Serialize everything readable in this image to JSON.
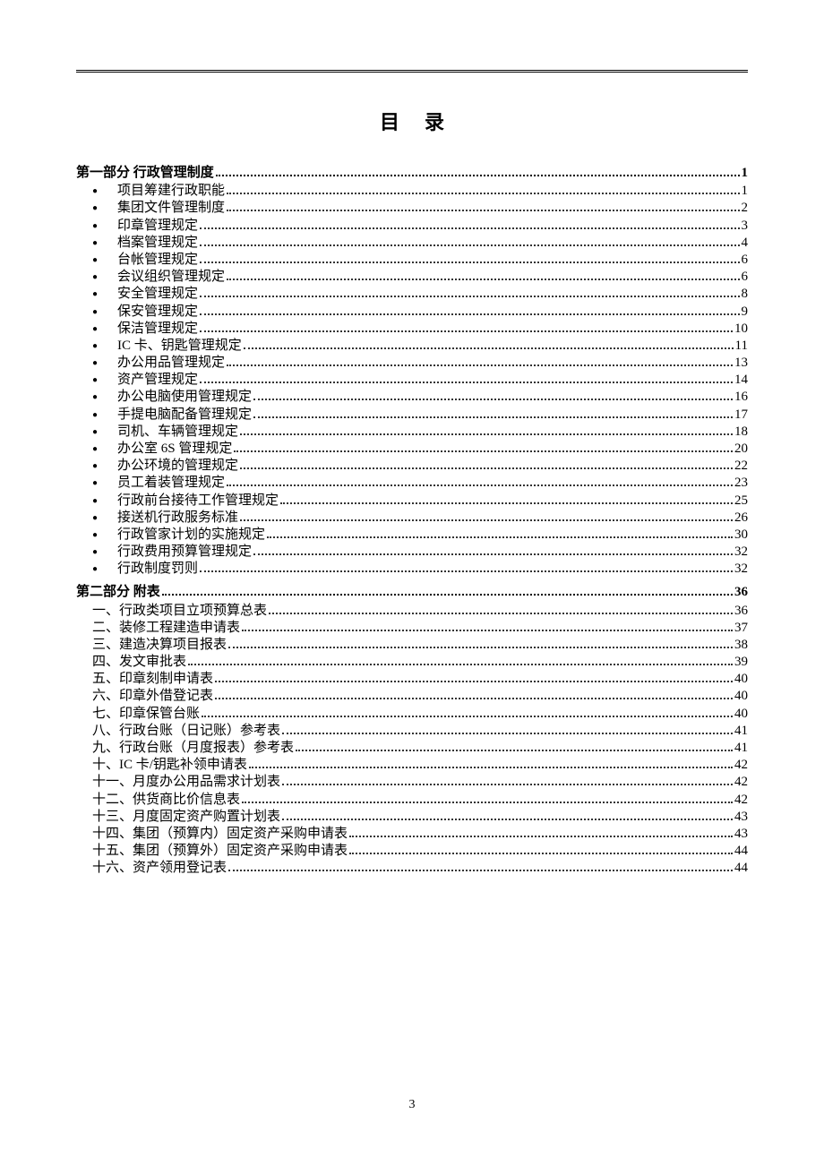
{
  "title": "目录",
  "page_number": "3",
  "sections": [
    {
      "heading": "第一部分  行政管理制度",
      "page": "1",
      "style": "bulleted",
      "items": [
        {
          "label": "项目筹建行政职能",
          "page": "1"
        },
        {
          "label": "集团文件管理制度",
          "page": "2"
        },
        {
          "label": "印章管理规定",
          "page": "3"
        },
        {
          "label": "档案管理规定",
          "page": "4"
        },
        {
          "label": "台帐管理规定",
          "page": "6"
        },
        {
          "label": "会议组织管理规定",
          "page": "6"
        },
        {
          "label": "安全管理规定",
          "page": "8"
        },
        {
          "label": "保安管理规定",
          "page": "9"
        },
        {
          "label": "保洁管理规定",
          "page": "10"
        },
        {
          "label": "IC 卡、钥匙管理规定",
          "page": "11"
        },
        {
          "label": "办公用品管理规定",
          "page": "13"
        },
        {
          "label": "资产管理规定",
          "page": "14"
        },
        {
          "label": "办公电脑使用管理规定",
          "page": "16"
        },
        {
          "label": "手提电脑配备管理规定",
          "page": "17"
        },
        {
          "label": "司机、车辆管理规定",
          "page": "18"
        },
        {
          "label": "办公室 6S 管理规定",
          "page": "20"
        },
        {
          "label": "办公环境的管理规定",
          "page": "22"
        },
        {
          "label": "员工着装管理规定",
          "page": "23"
        },
        {
          "label": "行政前台接待工作管理规定",
          "page": "25"
        },
        {
          "label": "接送机行政服务标准",
          "page": "26"
        },
        {
          "label": "行政管家计划的实施规定",
          "page": "30"
        },
        {
          "label": "行政费用预算管理规定",
          "page": "32"
        },
        {
          "label": "行政制度罚则",
          "page": "32"
        }
      ]
    },
    {
      "heading": "第二部分  附表",
      "page": "36",
      "style": "numbered",
      "items": [
        {
          "label": "一、行政类项目立项预算总表",
          "page": "36"
        },
        {
          "label": "二、装修工程建造申请表",
          "page": "37"
        },
        {
          "label": "三、建造决算项目报表",
          "page": "38"
        },
        {
          "label": "四、发文审批表",
          "page": "39"
        },
        {
          "label": "五、印章刻制申请表",
          "page": "40"
        },
        {
          "label": "六、印章外借登记表",
          "page": "40"
        },
        {
          "label": "七、印章保管台账",
          "page": "40"
        },
        {
          "label": "八、行政台账（日记账）参考表",
          "page": "41"
        },
        {
          "label": "九、行政台账（月度报表）参考表",
          "page": "41"
        },
        {
          "label": "十、IC 卡/钥匙补领申请表",
          "page": "42"
        },
        {
          "label": "十一、月度办公用品需求计划表",
          "page": "42"
        },
        {
          "label": "十二、供货商比价信息表",
          "page": "42"
        },
        {
          "label": "十三、月度固定资产购置计划表",
          "page": "43"
        },
        {
          "label": "十四、集团（预算内）固定资产采购申请表",
          "page": "43"
        },
        {
          "label": "十五、集团（预算外）固定资产采购申请表",
          "page": "44"
        },
        {
          "label": "十六、资产领用登记表",
          "page": "44"
        }
      ]
    }
  ]
}
